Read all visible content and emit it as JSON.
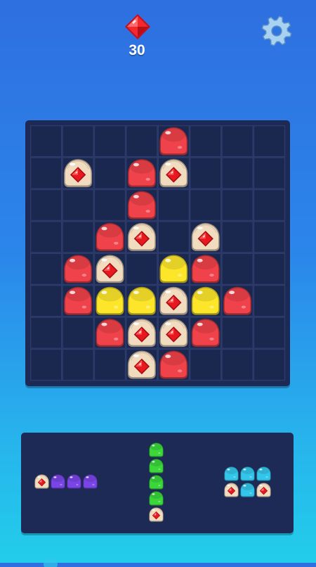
{
  "hud": {
    "gem_icon": "red-diamond-icon",
    "gem_count": "30",
    "settings_icon": "gear-icon"
  },
  "board": {
    "rows": 8,
    "cols": 8,
    "cells": [
      {
        "r": 0,
        "c": 4,
        "t": "red"
      },
      {
        "r": 1,
        "c": 1,
        "t": "gem"
      },
      {
        "r": 1,
        "c": 3,
        "t": "red"
      },
      {
        "r": 1,
        "c": 4,
        "t": "gem"
      },
      {
        "r": 2,
        "c": 3,
        "t": "red"
      },
      {
        "r": 3,
        "c": 2,
        "t": "red"
      },
      {
        "r": 3,
        "c": 3,
        "t": "gem"
      },
      {
        "r": 3,
        "c": 5,
        "t": "gem"
      },
      {
        "r": 4,
        "c": 1,
        "t": "red"
      },
      {
        "r": 4,
        "c": 2,
        "t": "gem"
      },
      {
        "r": 4,
        "c": 4,
        "t": "yellow"
      },
      {
        "r": 4,
        "c": 5,
        "t": "red"
      },
      {
        "r": 5,
        "c": 1,
        "t": "red"
      },
      {
        "r": 5,
        "c": 2,
        "t": "yellow"
      },
      {
        "r": 5,
        "c": 3,
        "t": "yellow"
      },
      {
        "r": 5,
        "c": 4,
        "t": "gem"
      },
      {
        "r": 5,
        "c": 5,
        "t": "yellow"
      },
      {
        "r": 5,
        "c": 6,
        "t": "red"
      },
      {
        "r": 6,
        "c": 2,
        "t": "red"
      },
      {
        "r": 6,
        "c": 3,
        "t": "gem"
      },
      {
        "r": 6,
        "c": 4,
        "t": "gem"
      },
      {
        "r": 6,
        "c": 5,
        "t": "red"
      },
      {
        "r": 7,
        "c": 3,
        "t": "gem"
      },
      {
        "r": 7,
        "c": 4,
        "t": "red"
      }
    ]
  },
  "tray": {
    "pieces": [
      {
        "name": "piece-horizontal-purple",
        "cells": [
          {
            "r": 0,
            "c": 0,
            "t": "gem"
          },
          {
            "r": 0,
            "c": 1,
            "t": "purple"
          },
          {
            "r": 0,
            "c": 2,
            "t": "purple"
          },
          {
            "r": 0,
            "c": 3,
            "t": "purple"
          }
        ]
      },
      {
        "name": "piece-vertical-green",
        "cells": [
          {
            "r": 0,
            "c": 0,
            "t": "green"
          },
          {
            "r": 1,
            "c": 0,
            "t": "green"
          },
          {
            "r": 2,
            "c": 0,
            "t": "green"
          },
          {
            "r": 3,
            "c": 0,
            "t": "green"
          },
          {
            "r": 4,
            "c": 0,
            "t": "gem"
          }
        ]
      },
      {
        "name": "piece-block-cyan",
        "cells": [
          {
            "r": 0,
            "c": 0,
            "t": "cyan"
          },
          {
            "r": 0,
            "c": 1,
            "t": "cyan"
          },
          {
            "r": 0,
            "c": 2,
            "t": "cyan"
          },
          {
            "r": 1,
            "c": 0,
            "t": "gem"
          },
          {
            "r": 1,
            "c": 1,
            "t": "cyan"
          },
          {
            "r": 1,
            "c": 2,
            "t": "gem"
          }
        ]
      }
    ]
  },
  "colors": {
    "red": "#f0424a",
    "yellow": "#fde62a",
    "purple": "#7a45e6",
    "green": "#3bd63a",
    "cyan": "#33c6ea",
    "gem_block": "#f2dcc0",
    "ruby": "#e8181f",
    "board_bg": "#1c2a55",
    "cell_bg": "#1a274f",
    "grid_line": "#2d3b6a"
  }
}
